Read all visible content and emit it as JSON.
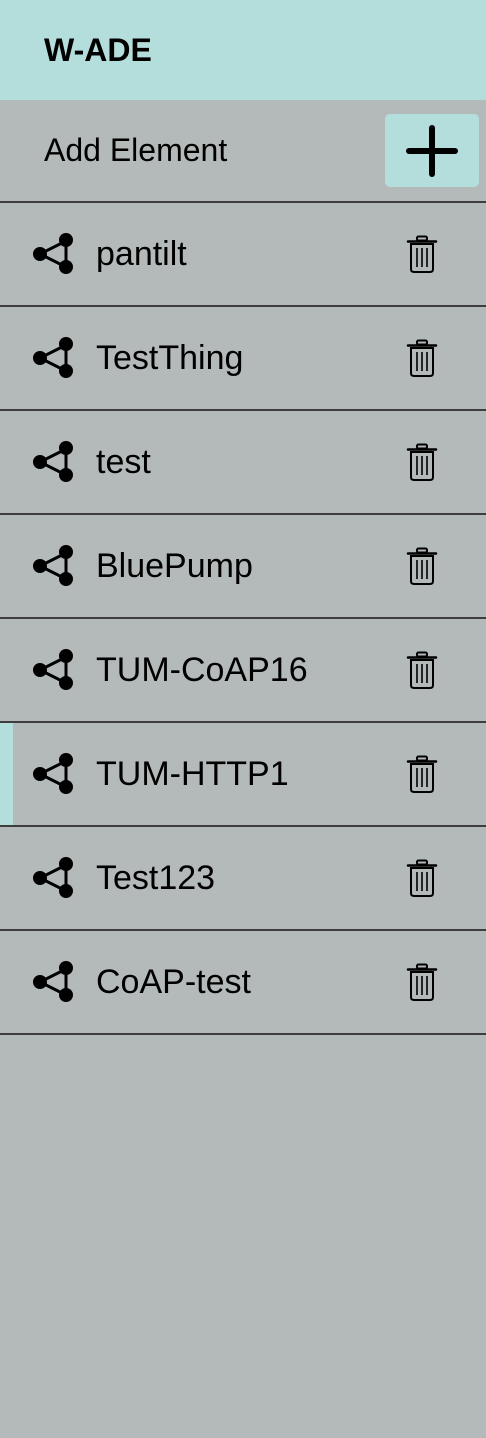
{
  "header": {
    "title": "W-ADE"
  },
  "add_element": {
    "label": "Add Element",
    "icon": "plus-icon"
  },
  "colors": {
    "accent": "#b4dedb",
    "background": "#b4b9b9",
    "divider": "#3d3d3d"
  },
  "items": [
    {
      "name": "pantilt",
      "active": false
    },
    {
      "name": "TestThing",
      "active": false
    },
    {
      "name": "test",
      "active": false
    },
    {
      "name": "BluePump",
      "active": false
    },
    {
      "name": "TUM-CoAP16",
      "active": false
    },
    {
      "name": "TUM-HTTP1",
      "active": true
    },
    {
      "name": "Test123",
      "active": false
    },
    {
      "name": "CoAP-test",
      "active": false
    }
  ]
}
